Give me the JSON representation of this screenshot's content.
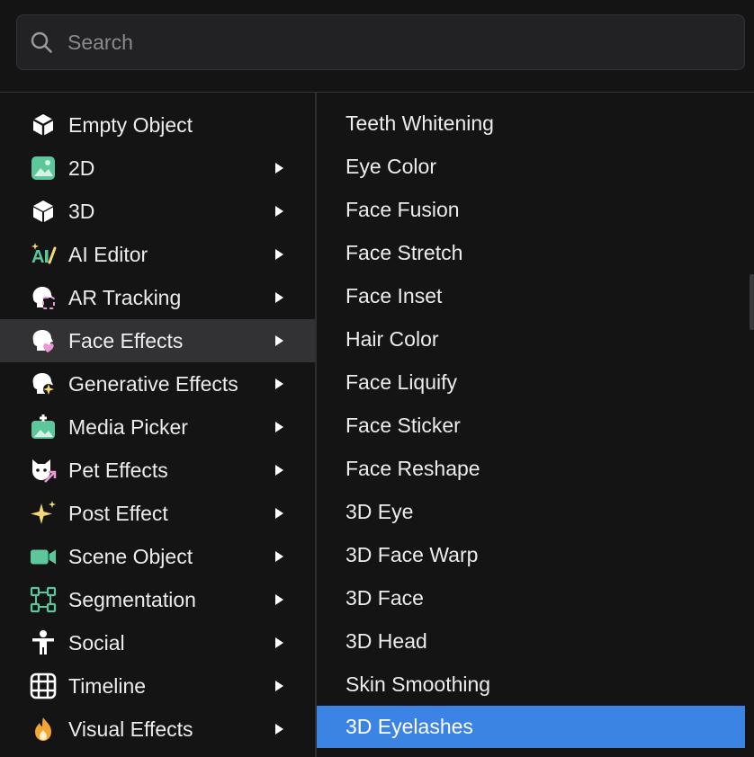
{
  "search": {
    "placeholder": "Search",
    "value": ""
  },
  "left_menu": {
    "items": [
      {
        "label": "Empty Object",
        "icon": "cube-outline-icon",
        "has_submenu": false
      },
      {
        "label": "2D",
        "icon": "image-icon",
        "has_submenu": true
      },
      {
        "label": "3D",
        "icon": "cube-icon",
        "has_submenu": true
      },
      {
        "label": "AI Editor",
        "icon": "ai-brush-icon",
        "has_submenu": true
      },
      {
        "label": "AR Tracking",
        "icon": "head-tracking-icon",
        "has_submenu": true
      },
      {
        "label": "Face Effects",
        "icon": "face-effects-icon",
        "has_submenu": true,
        "active": true
      },
      {
        "label": "Generative Effects",
        "icon": "head-sparkle-icon",
        "has_submenu": true
      },
      {
        "label": "Media Picker",
        "icon": "media-picker-icon",
        "has_submenu": true
      },
      {
        "label": "Pet Effects",
        "icon": "pet-icon",
        "has_submenu": true
      },
      {
        "label": "Post Effect",
        "icon": "sparkle-icon",
        "has_submenu": true
      },
      {
        "label": "Scene Object",
        "icon": "video-camera-icon",
        "has_submenu": true
      },
      {
        "label": "Segmentation",
        "icon": "segmentation-icon",
        "has_submenu": true
      },
      {
        "label": "Social",
        "icon": "person-icon",
        "has_submenu": true
      },
      {
        "label": "Timeline",
        "icon": "film-icon",
        "has_submenu": true
      },
      {
        "label": "Visual Effects",
        "icon": "flame-icon",
        "has_submenu": true
      }
    ]
  },
  "submenu": {
    "items": [
      "Teeth Whitening",
      "Eye Color",
      "Face Fusion",
      "Face Stretch",
      "Face Inset",
      "Hair Color",
      "Face Liquify",
      "Face Sticker",
      "Face Reshape",
      "3D Eye",
      "3D Face Warp",
      "3D Face",
      "3D Head",
      "Skin Smoothing",
      "3D Eyelashes"
    ],
    "selected": "3D Eyelashes"
  },
  "colors": {
    "background": "#141414",
    "active_row": "#323235",
    "selected_row": "#3b84e3",
    "icon_green": "#5cc79a",
    "icon_pink": "#e99ad6",
    "icon_yellow": "#f5d77a",
    "icon_orange": "#f3a531"
  }
}
